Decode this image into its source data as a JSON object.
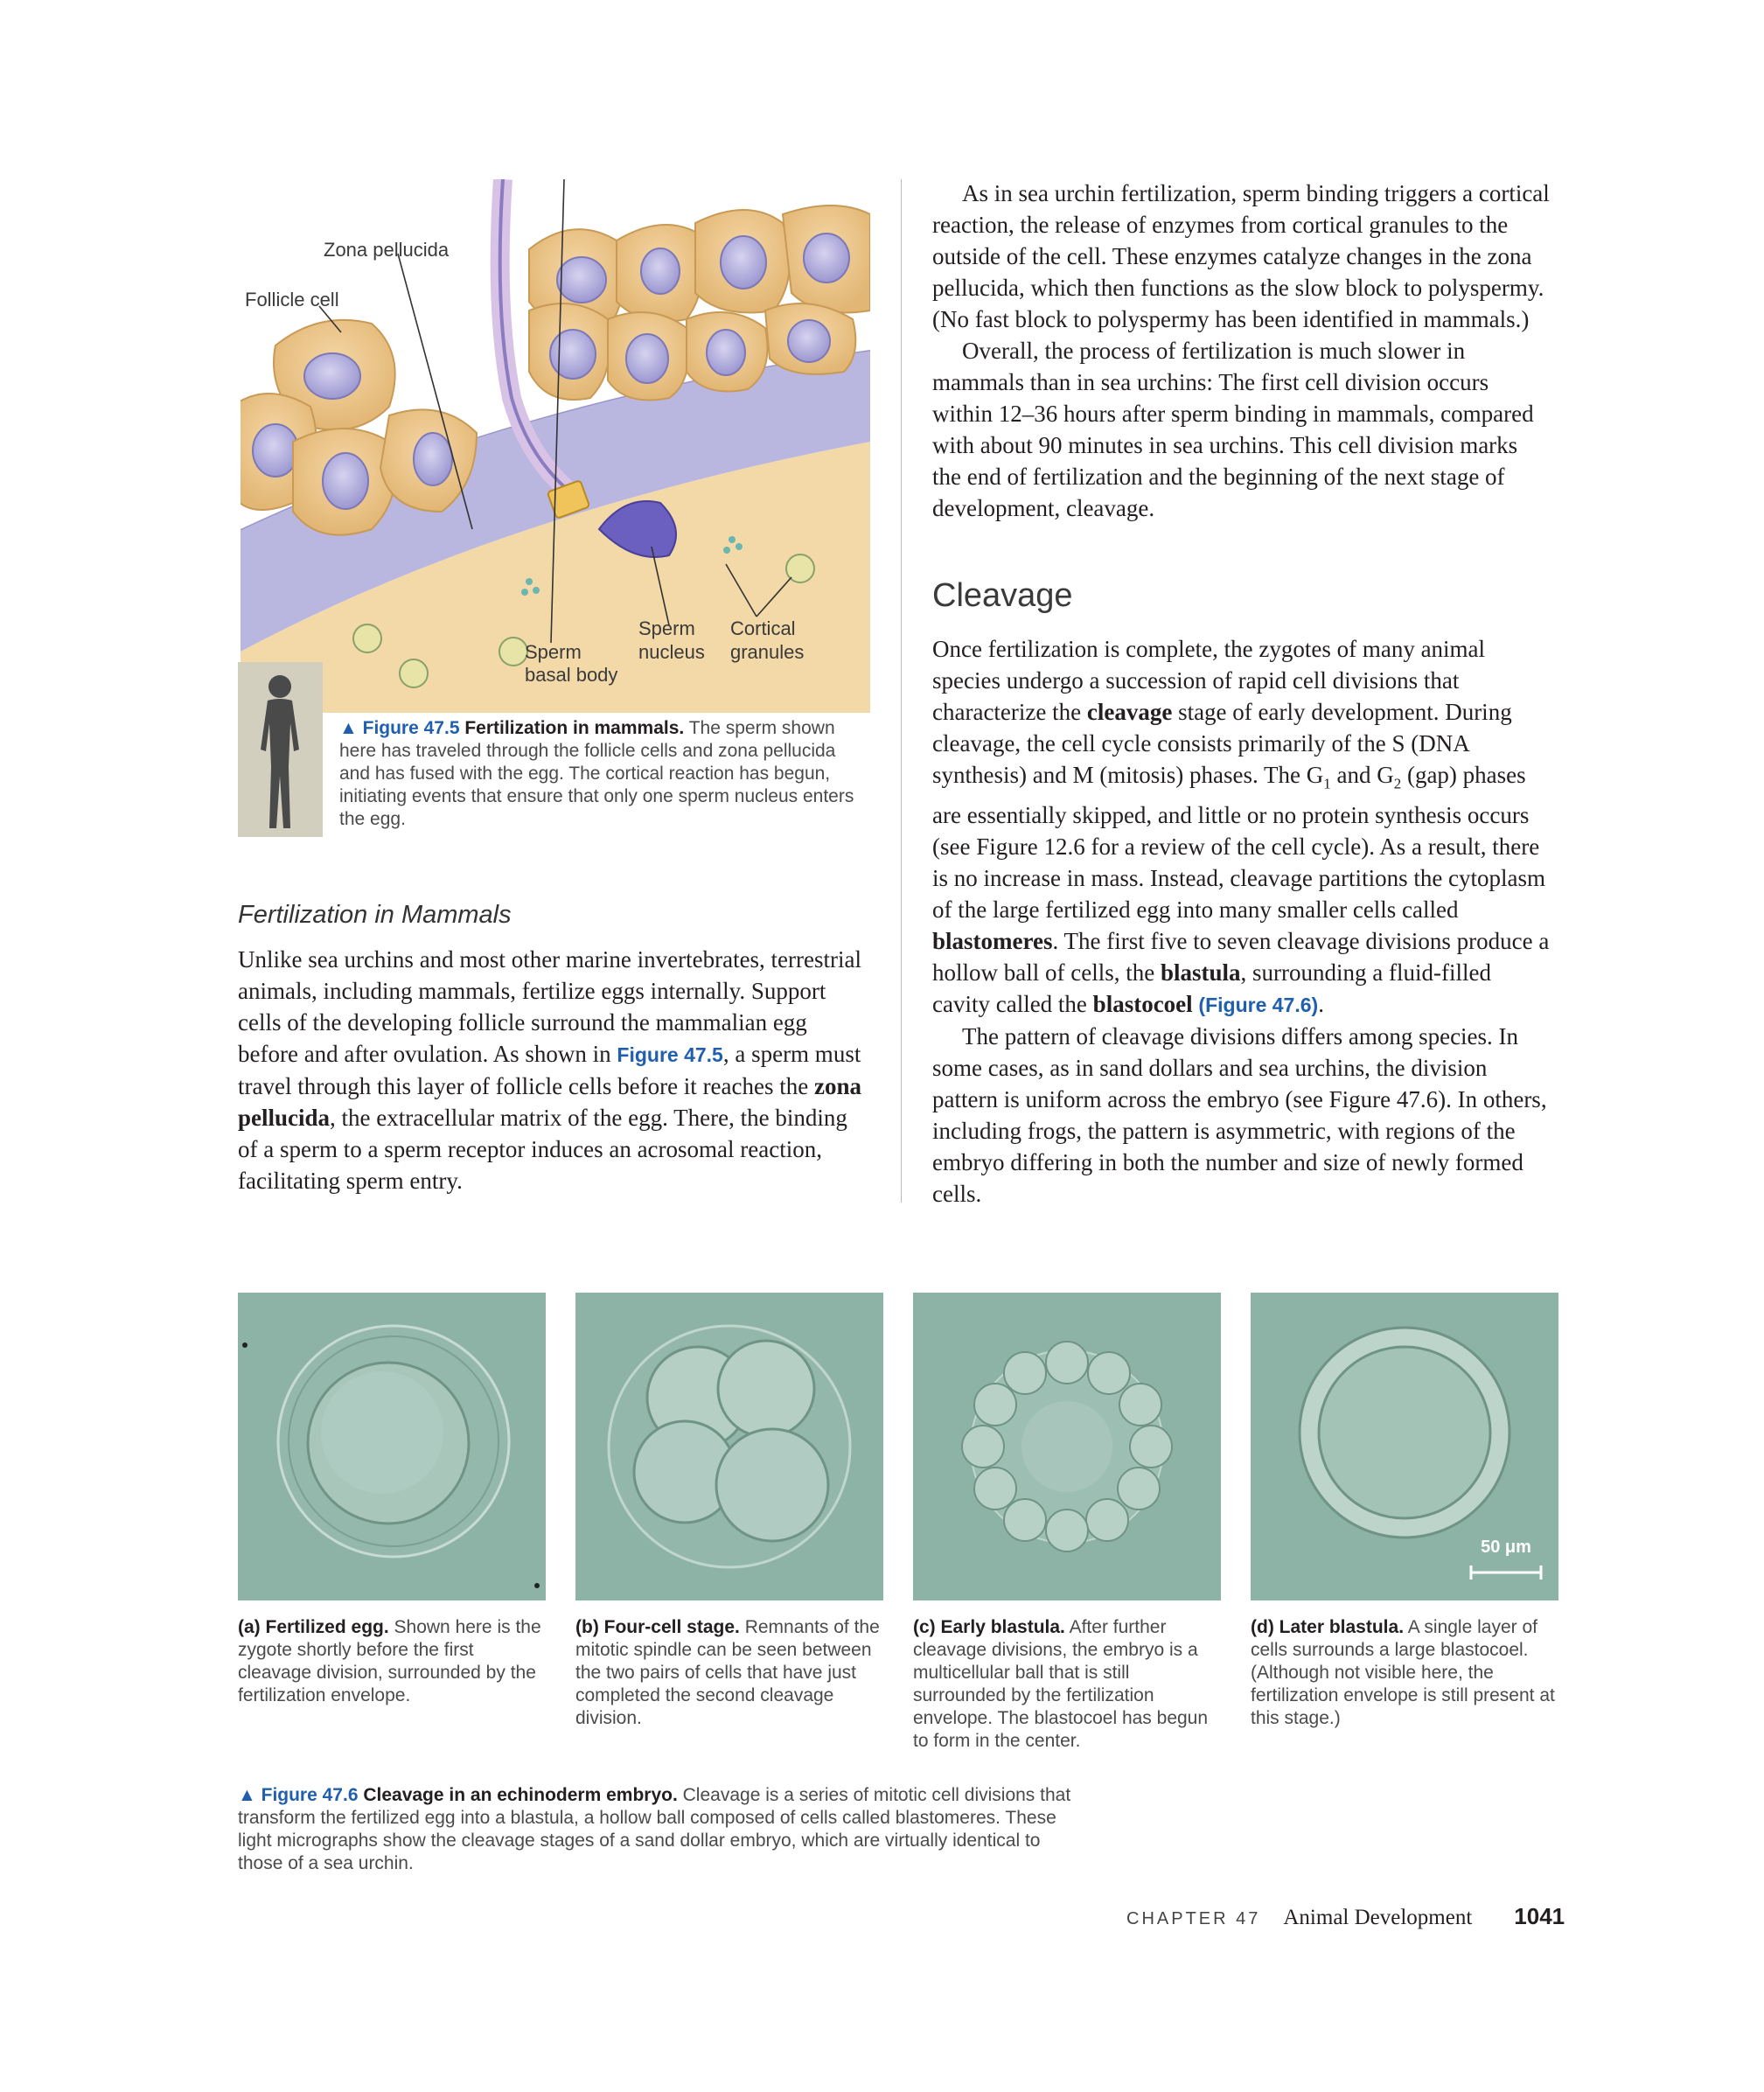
{
  "figure_47_5": {
    "labels": {
      "zona_pellucida": "Zona pellucida",
      "follicle_cell": "Follicle cell",
      "sperm_basal_body_1": "Sperm",
      "sperm_basal_body_2": "basal body",
      "sperm_nucleus_1": "Sperm",
      "sperm_nucleus_2": "nucleus",
      "cortical_granules_1": "Cortical",
      "cortical_granules_2": "granules"
    },
    "caption": {
      "marker": "▲ Figure 47.5",
      "title": "Fertilization in mammals.",
      "text": "The sperm shown here has traveled through the follicle cells and zona pellucida and has fused with the egg. The cortical reaction has begun, initiating events that ensure that only one sperm nucleus enters the egg."
    }
  },
  "left_column": {
    "heading": "Fertilization in Mammals",
    "paragraph": {
      "p1": "Unlike sea urchins and most other marine invertebrates, terrestrial animals, including mammals, fertilize eggs internally. Support cells of the developing follicle surround the mammalian egg before and after ovulation. As shown in ",
      "fig_ref": "Figure 47.5",
      "p2": ", a sperm must travel through this layer of follicle cells before it reaches the ",
      "bold1": "zona pellucida",
      "p3": ", the extracellular matrix of the egg. There, the binding of a sperm to a sperm receptor induces an acrosomal reaction, facilitating sperm entry."
    }
  },
  "right_column": {
    "para1": "As in sea urchin fertilization, sperm binding triggers a cortical reaction, the release of enzymes from cortical granules to the outside of the cell. These enzymes catalyze changes in the zona pellucida, which then functions as the slow block to polyspermy. (No fast block to polyspermy has been identified in mammals.)",
    "para2": "Overall, the process of fertilization is much slower in mammals than in sea urchins: The first cell division occurs within 12–36 hours after sperm binding in mammals, compared with about 90 minutes in sea urchins. This cell division marks the end of fertilization and the beginning of the next stage of development, cleavage.",
    "heading": "Cleavage",
    "para3": {
      "a": "Once fertilization is complete, the zygotes of many animal species undergo a succession of rapid cell divisions that characterize the ",
      "b_cleavage": "cleavage",
      "c": " stage of early development. During cleavage, the cell cycle consists primarily of the S (DNA synthesis) and M (mitosis) phases. The G",
      "sub1": "1",
      "d": " and G",
      "sub2": "2",
      "e": " (gap) phases are essentially skipped, and little or no protein synthesis occurs (see Figure 12.6 for a review of the cell cycle). As a result, there is no increase in mass. Instead, cleavage partitions the cytoplasm of the large fertilized egg into many smaller cells called ",
      "b_blastomeres": "blastomeres",
      "f": ". The first five to seven cleavage divisions produce a hollow ball of cells, the ",
      "b_blastula": "blastula",
      "g": ", surrounding a fluid-filled cavity called the ",
      "b_blastocoel": "blastocoel",
      "fig_ref": "(Figure 47.6)",
      "h": "."
    },
    "para4": "The pattern of cleavage divisions differs among species. In some cases, as in sand dollars and sea urchins, the division pattern is uniform across the embryo (see Figure 47.6). In others, including frogs, the pattern is asymmetric, with regions of the embryo differing in both the number and size of newly formed cells."
  },
  "figure_47_6": {
    "scale_bar": "50 μm",
    "panels": [
      {
        "lead": "(a) Fertilized egg.",
        "text": "Shown here is the zygote shortly before the first cleavage division, surrounded by the fertilization envelope."
      },
      {
        "lead": "(b) Four-cell stage.",
        "text": "Remnants of the mitotic spindle can be seen between the two pairs of cells that have just completed the second cleavage division."
      },
      {
        "lead": "(c) Early blastula.",
        "text": "After further cleavage divisions, the embryo is a multicellular ball that is still surrounded by the fertilization envelope. The blastocoel has begun to form in the center."
      },
      {
        "lead": "(d) Later blastula.",
        "text": "A single layer of cells surrounds a large blastocoel. (Although not visible here, the fertilization envelope is still present at this stage.)"
      }
    ],
    "caption": {
      "marker": "▲ Figure 47.6",
      "title": "Cleavage in an echinoderm embryo.",
      "text": "Cleavage is a series of mitotic cell divisions that transform the fertilized egg into a blastula, a hollow ball composed of cells called blastomeres. These light micrographs show the cleavage stages of a sand dollar embryo, which are virtually identical to those of a sea urchin."
    }
  },
  "footer": {
    "chapter": "CHAPTER 47",
    "title": "Animal Development",
    "page": "1041"
  }
}
